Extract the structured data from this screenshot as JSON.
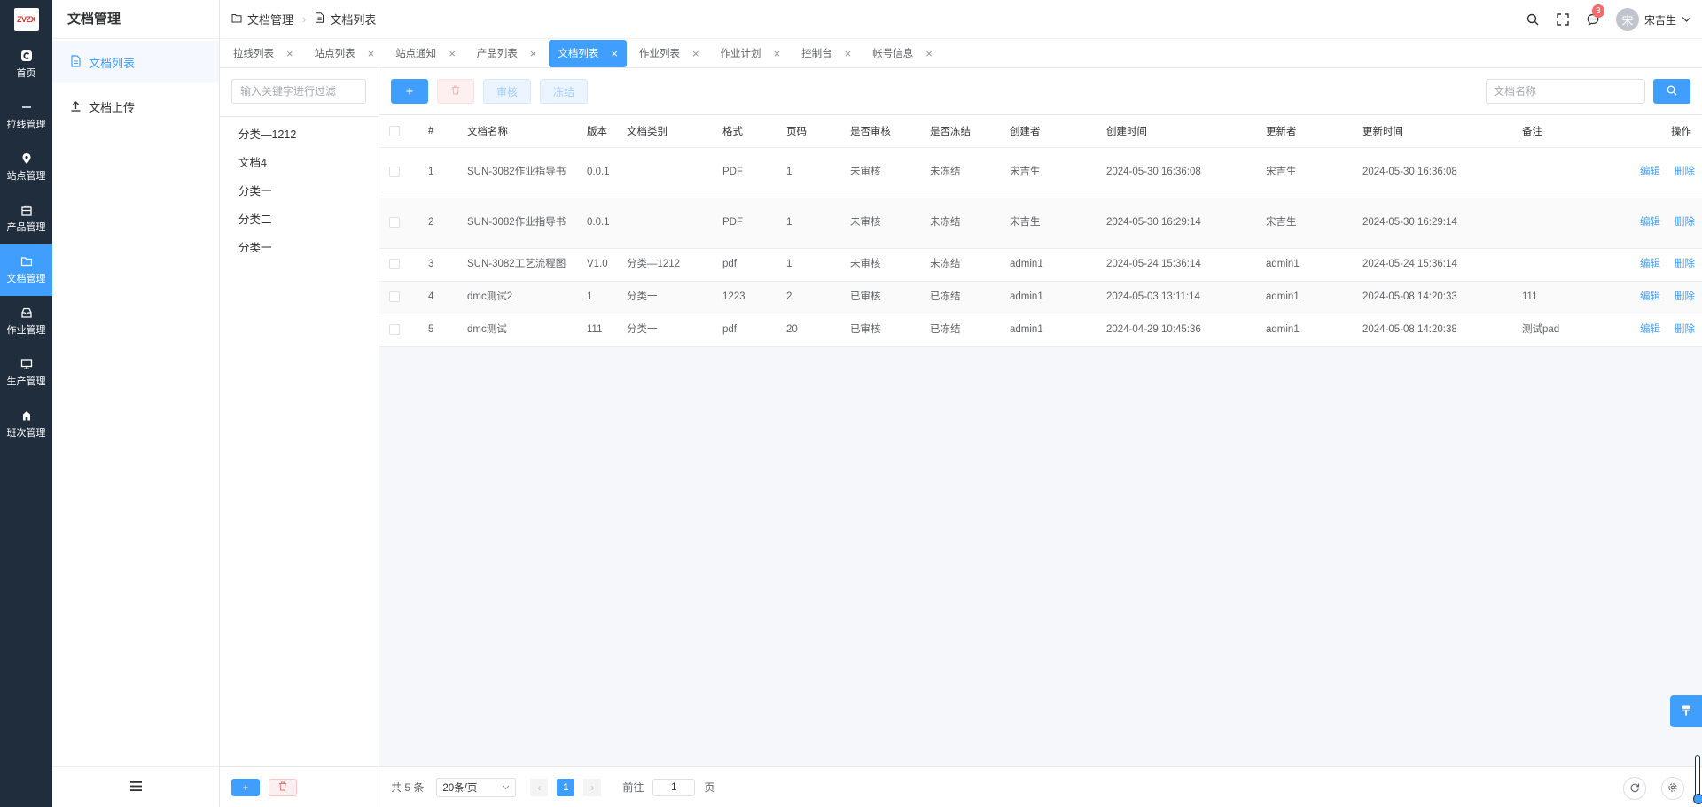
{
  "colors": {
    "primary": "#409eff",
    "rail_bg": "#1f2d3d",
    "danger": "#f56c6c"
  },
  "rail": {
    "logo_text": "ZVZX",
    "items": [
      {
        "label": "首页",
        "icon": "home-c-icon"
      },
      {
        "label": "拉线管理",
        "icon": "line-icon"
      },
      {
        "label": "站点管理",
        "icon": "location-pin-icon"
      },
      {
        "label": "产品管理",
        "icon": "bag-icon"
      },
      {
        "label": "文档管理",
        "icon": "folder-icon"
      },
      {
        "label": "作业管理",
        "icon": "tray-icon"
      },
      {
        "label": "生产管理",
        "icon": "monitor-icon"
      },
      {
        "label": "班次管理",
        "icon": "house-icon"
      }
    ]
  },
  "submenu": {
    "title": "文档管理",
    "items": [
      {
        "label": "文档列表",
        "icon": "document-icon"
      },
      {
        "label": "文档上传",
        "icon": "upload-icon"
      }
    ]
  },
  "header": {
    "breadcrumb": [
      "文档管理",
      "文档列表"
    ],
    "notification_count": "3",
    "user_avatar": "宋",
    "user_name": "宋吉生"
  },
  "tags": [
    {
      "label": "拉线列表"
    },
    {
      "label": "站点列表"
    },
    {
      "label": "站点通知"
    },
    {
      "label": "产品列表"
    },
    {
      "label": "文档列表",
      "active": true
    },
    {
      "label": "作业列表"
    },
    {
      "label": "作业计划"
    },
    {
      "label": "控制台"
    },
    {
      "label": "帐号信息"
    }
  ],
  "categories": {
    "filter_placeholder": "输入关键字进行过滤",
    "items": [
      "分类—1212",
      "文档4",
      "分类一",
      "分类二",
      "分类一"
    ]
  },
  "toolbar": {
    "audit_label": "审核",
    "freeze_label": "冻结",
    "search_placeholder": "文档名称"
  },
  "table": {
    "columns": [
      "#",
      "文档名称",
      "版本",
      "文档类别",
      "格式",
      "页码",
      "是否审核",
      "是否冻结",
      "创建者",
      "创建时间",
      "更新者",
      "更新时间",
      "备注",
      "操作"
    ],
    "rows": [
      {
        "idx": "1",
        "name": "SUN-3082作业指导书",
        "version": "0.0.1",
        "category": "",
        "format": "PDF",
        "pages": "1",
        "audited": "未审核",
        "frozen": "未冻结",
        "creator": "宋吉生",
        "created": "2024-05-30 16:36:08",
        "updater": "宋吉生",
        "updated": "2024-05-30 16:36:08",
        "remark": ""
      },
      {
        "idx": "2",
        "name": "SUN-3082作业指导书",
        "version": "0.0.1",
        "category": "",
        "format": "PDF",
        "pages": "1",
        "audited": "未审核",
        "frozen": "未冻结",
        "creator": "宋吉生",
        "created": "2024-05-30 16:29:14",
        "updater": "宋吉生",
        "updated": "2024-05-30 16:29:14",
        "remark": ""
      },
      {
        "idx": "3",
        "name": "SUN-3082工艺流程图",
        "version": "V1.0",
        "category": "分类—1212",
        "format": "pdf",
        "pages": "1",
        "audited": "未审核",
        "frozen": "未冻结",
        "creator": "admin1",
        "created": "2024-05-24 15:36:14",
        "updater": "admin1",
        "updated": "2024-05-24 15:36:14",
        "remark": ""
      },
      {
        "idx": "4",
        "name": "dmc测试2",
        "version": "1",
        "category": "分类一",
        "format": "1223",
        "pages": "2",
        "audited": "已审核",
        "frozen": "已冻结",
        "creator": "admin1",
        "created": "2024-05-03 13:11:14",
        "updater": "admin1",
        "updated": "2024-05-08 14:20:33",
        "remark": "111"
      },
      {
        "idx": "5",
        "name": "dmc测试",
        "version": "111",
        "category": "分类一",
        "format": "pdf",
        "pages": "20",
        "audited": "已审核",
        "frozen": "已冻结",
        "creator": "admin1",
        "created": "2024-04-29 10:45:36",
        "updater": "admin1",
        "updated": "2024-05-08 14:20:38",
        "remark": "测试pad"
      }
    ],
    "edit_label": "编辑",
    "delete_label": "删除"
  },
  "pager": {
    "total_text": "共 5 条",
    "page_size": "20条/页",
    "current_page": "1",
    "goto_label": "前往",
    "goto_value": "1",
    "page_unit": "页"
  }
}
